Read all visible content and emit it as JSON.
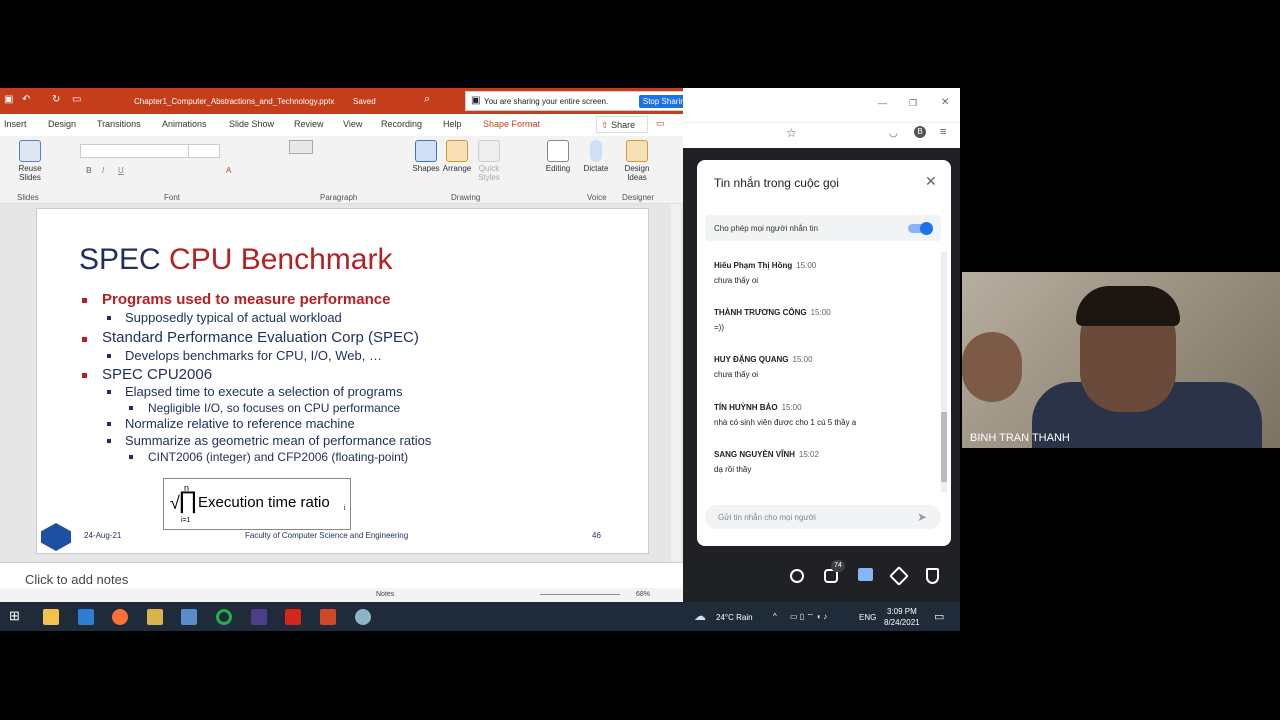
{
  "ppt": {
    "file_title": "Chapter1_Computer_Abstractions_and_Technology.pptx",
    "saved_status": "Saved",
    "tabs": [
      "Insert",
      "Design",
      "Transitions",
      "Animations",
      "Slide Show",
      "Review",
      "View",
      "Recording",
      "Help",
      "Shape Format"
    ],
    "share_label": "Share",
    "ribbon": {
      "reuse_slides": "Reuse Slides",
      "group_slides": "Slides",
      "group_font": "Font",
      "group_paragraph": "Paragraph",
      "group_drawing": "Drawing",
      "group_voice": "Voice",
      "group_designer": "Designer",
      "shapes": "Shapes",
      "arrange": "Arrange",
      "quick_styles": "Quick Styles",
      "editing": "Editing",
      "dictate": "Dictate",
      "design_ideas": "Design Ideas"
    },
    "notes_placeholder": "Click to add notes",
    "status": {
      "notes": "Notes",
      "zoom": "68%"
    }
  },
  "share_banner": {
    "text": "You are sharing your entire screen.",
    "stop_label": "Stop Sharing"
  },
  "slide": {
    "title_part1": "SPEC",
    "title_part2": "CPU Benchmark",
    "bullets": {
      "b1": "Programs used to measure performance",
      "b1_1": "Supposedly typical of actual workload",
      "b2": "Standard Performance Evaluation Corp (SPEC)",
      "b2_1": "Develops benchmarks for CPU, I/O, Web, …",
      "b3": "SPEC CPU2006",
      "b3_1": "Elapsed time to execute a selection of programs",
      "b3_1_1": "Negligible I/O, so focuses on CPU performance",
      "b3_2": "Normalize relative to reference machine",
      "b3_3": "Summarize as geometric mean of performance ratios",
      "b3_3_1": "CINT2006 (integer) and CFP2006 (floating-point)"
    },
    "formula": {
      "n": "n",
      "i": "i=1",
      "text": "Execution time ratio",
      "sub": "i"
    },
    "footer": {
      "date": "24-Aug-21",
      "faculty": "Faculty of Computer Science and Engineering",
      "page": "46"
    }
  },
  "chat": {
    "title": "Tin nhắn trong cuộc gọi",
    "allow_label": "Cho phép mọi người nhắn tin",
    "messages": [
      {
        "name": "Hiếu Phạm Thị Hồng",
        "time": "15:00",
        "text": "chưa thấy oi"
      },
      {
        "name": "THÀNH TRƯƠNG CÔNG",
        "time": "15:00",
        "text": "=))"
      },
      {
        "name": "HUY ĐẶNG QUANG",
        "time": "15:00",
        "text": "chưa thấy oi"
      },
      {
        "name": "TÍN HUỲNH BẢO",
        "time": "15:00",
        "text": "nhà có sinh viên được cho 1 cú 5 thầy a"
      },
      {
        "name": "SANG NGUYỄN VĨNH",
        "time": "15:02",
        "text": "dạ rồi thầy"
      }
    ],
    "input_placeholder": "Gửi tin nhắn cho mọi người",
    "participants_count": "74"
  },
  "taskbar": {
    "weather": "24°C  Rain",
    "lang": "ENG",
    "time": "3:09 PM",
    "date": "8/24/2021"
  },
  "webcam": {
    "name": "BINH TRAN THANH"
  },
  "colors": {
    "ppt_red": "#c43e1c",
    "slide_navy": "#1f2e5c",
    "slide_red": "#b22222",
    "meet_blue": "#1a73e8"
  }
}
